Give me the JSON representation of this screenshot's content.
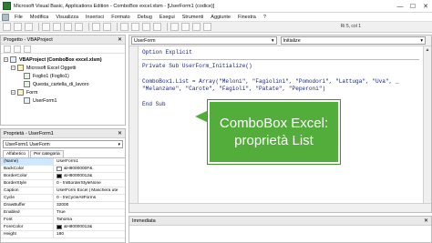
{
  "window": {
    "title": "Microsoft Visual Basic, Applications Edition - ComboBox excel.xlsm - [UserForm1 (codice)]",
    "minimize": "—",
    "maximize": "☐",
    "close": "✕"
  },
  "menu": [
    "File",
    "Modifica",
    "Visualizza",
    "Inserisci",
    "Formato",
    "Debug",
    "Esegui",
    "Strumenti",
    "Aggiunte",
    "Finestra",
    "?"
  ],
  "toolbar": {
    "position": "Ri 5, col 1"
  },
  "project": {
    "title": "Progetto - VBAProject",
    "tree": [
      {
        "label": "VBAProject (ComboBox excel.xlsm)",
        "level": 0,
        "bold": true,
        "expander": "−"
      },
      {
        "label": "Microsoft Excel Oggetti",
        "level": 1,
        "bold": false,
        "expander": "−"
      },
      {
        "label": "Foglio1 (Foglio1)",
        "level": 2,
        "bold": false,
        "expander": ""
      },
      {
        "label": "Questa_cartella_di_lavoro",
        "level": 2,
        "bold": false,
        "expander": ""
      },
      {
        "label": "Form",
        "level": 1,
        "bold": false,
        "expander": "−"
      },
      {
        "label": "UserForm1",
        "level": 2,
        "bold": false,
        "expander": ""
      }
    ]
  },
  "properties": {
    "title": "Proprietà - UserForm1",
    "object": "UserForm1 UserForm",
    "tabs": [
      "Alfabetico",
      "Per categoria"
    ],
    "rows": [
      {
        "name": "(Name)",
        "value": "UserForm1",
        "swatch": ""
      },
      {
        "name": "BackColor",
        "value": "&H8000000F&",
        "swatch": "#f0f0f0"
      },
      {
        "name": "BorderColor",
        "value": "&H80000012&",
        "swatch": "#000000"
      },
      {
        "name": "BorderStyle",
        "value": "0 - fmBorderStyleNone",
        "swatch": ""
      },
      {
        "name": "Caption",
        "value": "UserForm Excel | Maschera ute",
        "swatch": ""
      },
      {
        "name": "Cycle",
        "value": "0 - fmCycleAllForms",
        "swatch": ""
      },
      {
        "name": "DrawBuffer",
        "value": "32000",
        "swatch": ""
      },
      {
        "name": "Enabled",
        "value": "True",
        "swatch": ""
      },
      {
        "name": "Font",
        "value": "Tahoma",
        "swatch": ""
      },
      {
        "name": "ForeColor",
        "value": "&H80000012&",
        "swatch": "#000000"
      },
      {
        "name": "Height",
        "value": "180",
        "swatch": ""
      }
    ]
  },
  "code": {
    "object_combo": "UserForm",
    "proc_combo": "Initialize",
    "lines": [
      "Option Explicit",
      "",
      "Private Sub UserForm_Initialize()",
      "",
      "ComboBox1.List = Array(\"Meloni\", \"Fagiolini\", \"Pomodori\", \"Lattuga\", \"Uva\", _",
      "\"Melanzane\", \"Carote\", \"Fagioli\", \"Patate\", \"Peperoni\")",
      "",
      "End Sub"
    ]
  },
  "callout": {
    "line1": "ComboBox Excel:",
    "line2": "proprietà List",
    "color": "#52ad3b"
  },
  "immediate": {
    "title": "Immediata"
  }
}
